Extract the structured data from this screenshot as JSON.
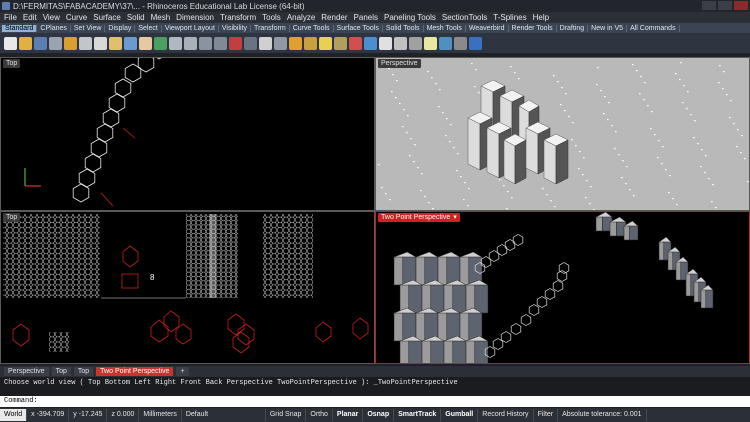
{
  "window": {
    "title": "D:\\FERMITAS\\FABACADEMY\\37\\... - Rhinoceros Educational Lab License (64-bit)"
  },
  "menu": [
    "File",
    "Edit",
    "View",
    "Curve",
    "Surface",
    "Solid",
    "Mesh",
    "Dimension",
    "Transform",
    "Tools",
    "Analyze",
    "Render",
    "Panels",
    "Paneling Tools",
    "SectionTools",
    "T-Splines",
    "Help"
  ],
  "toolbar_tabs": [
    "Standard",
    "CPlanes",
    "Set View",
    "Display",
    "Select",
    "Viewport Layout",
    "Visibility",
    "Transform",
    "Curve Tools",
    "Surface Tools",
    "Solid Tools",
    "Mesh Tools",
    "Weaverbird",
    "Render Tools",
    "Drafting",
    "New in V5",
    "All Commands"
  ],
  "viewports": {
    "top_left": {
      "label": "Top"
    },
    "top_right": {
      "label": "Perspective"
    },
    "bottom_left": {
      "label": "Top",
      "text_marker": "8"
    },
    "bottom_right": {
      "label": "Two Point Perspective",
      "caret": "▾"
    }
  },
  "viewport_tabs": [
    "Perspective",
    "Top",
    "Top",
    "Two Point Perspective",
    "+"
  ],
  "command": {
    "history": "Choose world view ( Top  Bottom  Left  Right  Front  Back  Perspective  TwoPointPerspective ): _TwoPointPerspective",
    "prompt": "Command:",
    "value": ""
  },
  "status": {
    "cplane": "World",
    "x": "x -394.709",
    "y": "y -17.245",
    "z": "z 0.000",
    "units": "Millimeters",
    "layer": "Default",
    "toggles": [
      "Grid Snap",
      "Ortho",
      "Planar",
      "Osnap",
      "SmartTrack",
      "Gumball",
      "Record History",
      "Filter"
    ],
    "tolerance": "Absolute tolerance: 0.001"
  },
  "colors": {
    "accent_red": "#c9352d",
    "grid_red": "#c8201e",
    "viewport_bg": "#000000",
    "perspective_bg": "#b9b9b9"
  }
}
